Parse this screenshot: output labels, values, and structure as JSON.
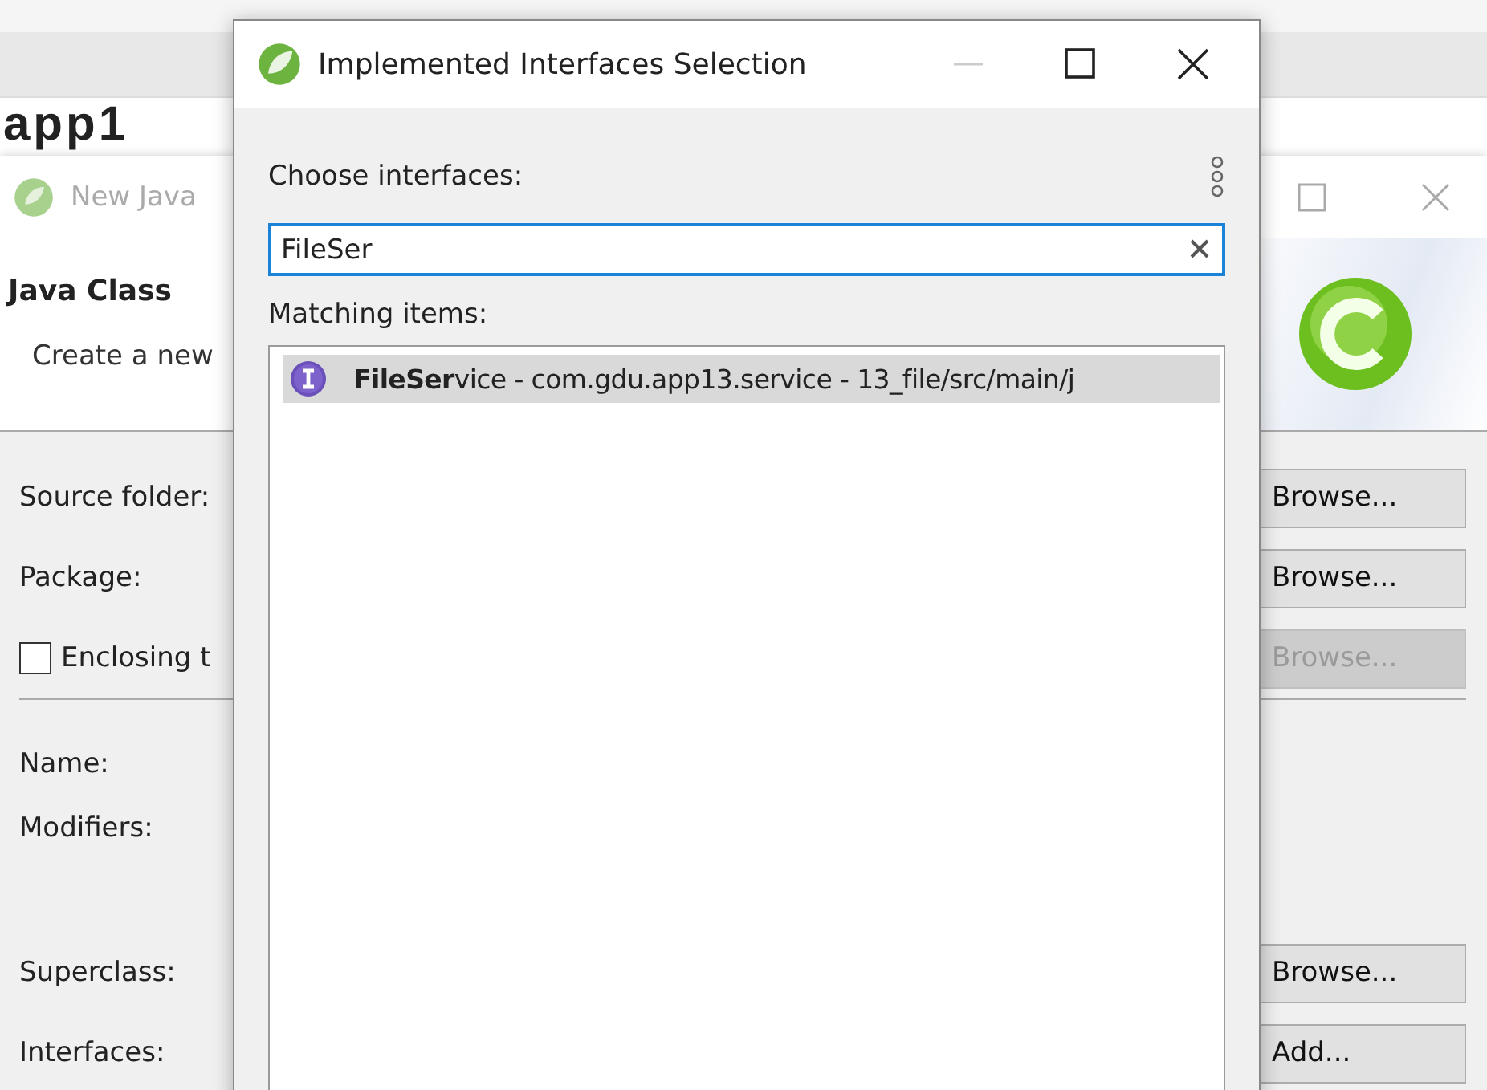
{
  "editor": {
    "heading": "app1"
  },
  "back_dialog": {
    "title": "New Java",
    "header_title": "Java Class",
    "header_description": "Create a new",
    "fields": [
      {
        "kind": "label",
        "label": "Source folder:",
        "button": {
          "label": "Browse...",
          "disabled": false
        }
      },
      {
        "kind": "label",
        "label": "Package:",
        "button": {
          "label": "Browse...",
          "disabled": false
        }
      },
      {
        "kind": "checkbox",
        "label": "Enclosing t",
        "checked": false,
        "button": {
          "label": "Browse...",
          "disabled": true
        }
      },
      {
        "kind": "separator"
      },
      {
        "kind": "label",
        "label": "Name:"
      },
      {
        "kind": "label",
        "label": "Modifiers:"
      },
      {
        "kind": "spacer"
      },
      {
        "kind": "label",
        "label": "Superclass:",
        "button": {
          "label": "Browse...",
          "disabled": false
        }
      },
      {
        "kind": "label",
        "label": "Interfaces:",
        "button": {
          "label": "Add...",
          "disabled": false
        }
      }
    ]
  },
  "dialog": {
    "title": "Implemented Interfaces Selection",
    "prompt": "Choose interfaces:",
    "search": {
      "value": "FileSer"
    },
    "list_label": "Matching items:",
    "items": [
      {
        "text": "**FileSer**vice - com.gdu.app13.service - 13_file/src/main/j",
        "selected": true
      }
    ]
  }
}
